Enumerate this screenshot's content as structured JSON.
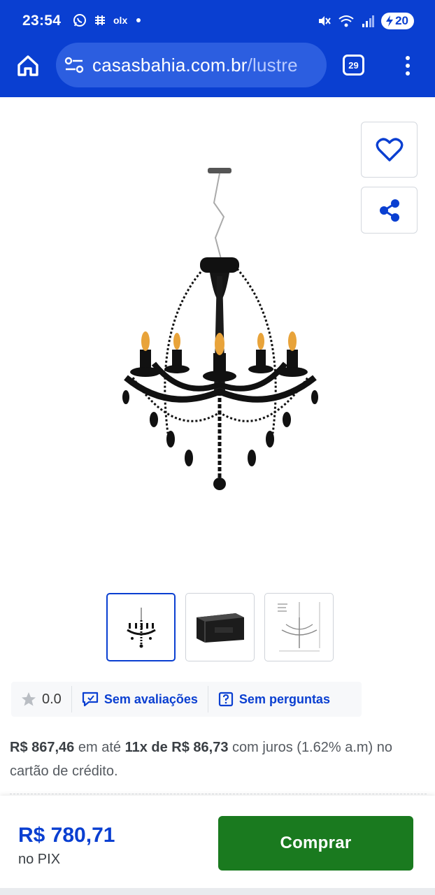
{
  "status_bar": {
    "time": "23:54",
    "notification_text": "olx",
    "battery": "20",
    "icons": [
      "whatsapp-icon",
      "olx-icon",
      "mute-icon",
      "wifi-icon",
      "signal-icon",
      "battery-icon"
    ]
  },
  "browser": {
    "url_domain": "casasbahia.com.br",
    "url_path": "/lustre",
    "tab_count": "29",
    "icons": [
      "home-icon",
      "site-settings-icon",
      "tabs-icon",
      "more-vert-icon"
    ]
  },
  "product": {
    "actions": [
      "heart-icon",
      "share-icon"
    ],
    "thumbnails": [
      "chandelier-photo",
      "chandelier-box",
      "chandelier-dimensions"
    ]
  },
  "rating": {
    "score": "0.0",
    "reviews_label": "Sem avaliações",
    "questions_label": "Sem perguntas"
  },
  "installments": {
    "total": "R$ 867,46",
    "text_in": "em até",
    "plan": "11x de R$ 86,73",
    "interest": "com juros (1.62% a.m) no cartão de crédito."
  },
  "buy": {
    "price": "R$ 780,71",
    "method": "no PIX",
    "button_label": "Comprar"
  },
  "colors": {
    "brand_blue": "#0a3fd1",
    "buy_green": "#1a7a1f"
  }
}
